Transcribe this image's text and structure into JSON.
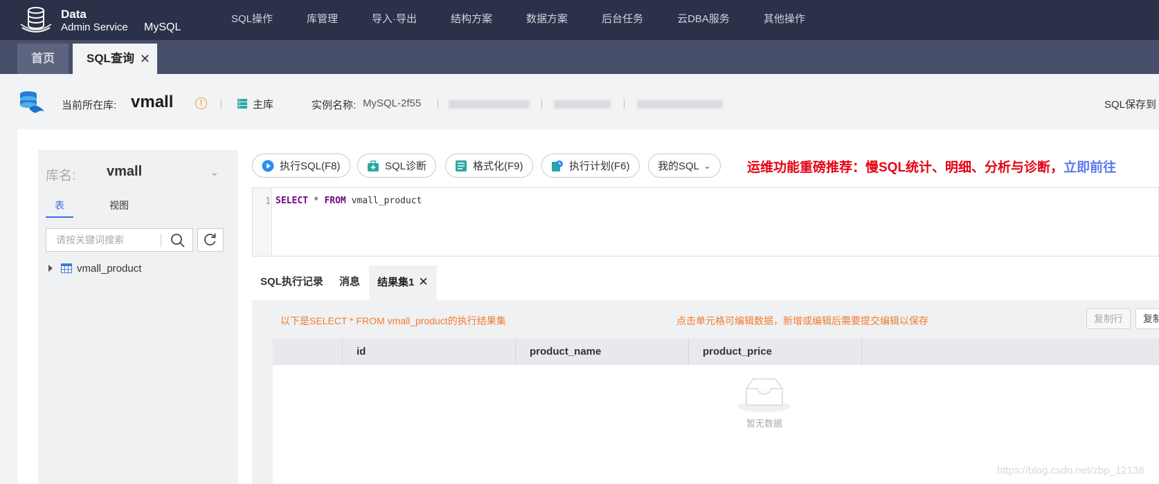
{
  "brand": {
    "line1": "Data",
    "line2": "Admin Service",
    "db_type": "MySQL"
  },
  "nav": {
    "items": [
      {
        "label": "SQL操作"
      },
      {
        "label": "库管理"
      },
      {
        "label": "导入·导出"
      },
      {
        "label": "结构方案"
      },
      {
        "label": "数据方案"
      },
      {
        "label": "后台任务"
      },
      {
        "label": "云DBA服务"
      },
      {
        "label": "其他操作"
      }
    ]
  },
  "tabs": {
    "home": "首页",
    "sql_query": "SQL查询",
    "close": "✕"
  },
  "info": {
    "current_db_label": "当前所在库:",
    "current_db": "vmall",
    "role": "主库",
    "instance_label": "实例名称:",
    "instance_name": "MySQL-2f55",
    "save_link": "SQL保存到"
  },
  "sidebar": {
    "db_label": "库名:",
    "db_name": "vmall",
    "tab_table": "表",
    "tab_view": "视图",
    "search_placeholder": "请按关键词搜索",
    "tables": [
      {
        "name": "vmall_product"
      }
    ]
  },
  "toolbar": {
    "execute": "执行SQL(F8)",
    "diagnose": "SQL诊断",
    "format": "格式化(F9)",
    "plan": "执行计划(F6)",
    "my_sql": "我的SQL",
    "promo_text": "运维功能重磅推荐：慢SQL统计、明细、分析与诊断，",
    "promo_link": "立即前往"
  },
  "editor": {
    "line_number": "1",
    "kw_select": "SELECT",
    "star": " * ",
    "kw_from": "FROM",
    "table": " vmall_product"
  },
  "result_tabs": {
    "history": "SQL执行记录",
    "messages": "消息",
    "result1": "结果集1",
    "close": "✕"
  },
  "result": {
    "message": "以下是SELECT * FROM vmall_product的执行结果集",
    "hint": "点击单元格可编辑数据，新增或编辑后需要提交编辑以保存",
    "copy_row": "复制行",
    "copy_col": "复制",
    "columns": [
      "id",
      "product_name",
      "product_price"
    ],
    "empty": "暂无数据"
  },
  "watermark": "https://blog.csdn.net/zbp_12138",
  "colors": {
    "nav_bg": "#2b3148",
    "tabbar_bg": "#474e6a",
    "accent": "#3a6fe8",
    "promo": "#e60012",
    "warning": "#f07c2c"
  }
}
